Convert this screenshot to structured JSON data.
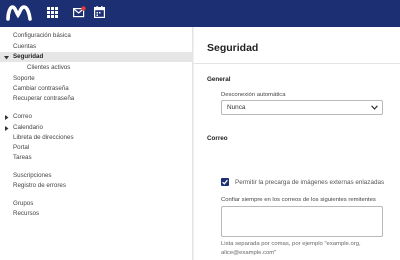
{
  "topbar": {
    "brand_color": "#1c2f73",
    "logo": "movistar-m-logo",
    "icons": [
      "apps-grid-icon",
      "mail-icon",
      "calendar-icon"
    ],
    "mail_badge_color": "#e53935"
  },
  "sidebar": {
    "items": [
      {
        "label": "Configuración básica"
      },
      {
        "label": "Cuentas"
      },
      {
        "label": "Seguridad",
        "expanded": true,
        "selected": true
      },
      {
        "label": "Clientes activos"
      },
      {
        "label": "Soporte"
      },
      {
        "label": "Cambiar contraseña"
      },
      {
        "label": "Recuperar contraseña"
      },
      {
        "label": "Correo",
        "collapsed": true
      },
      {
        "label": "Calendario",
        "collapsed": true
      },
      {
        "label": "Libreta de direcciones"
      },
      {
        "label": "Portal"
      },
      {
        "label": "Tareas"
      },
      {
        "label": "Suscripciones"
      },
      {
        "label": "Registro de errores"
      },
      {
        "label": "Grupos"
      },
      {
        "label": "Recursos"
      }
    ]
  },
  "main": {
    "title": "Seguridad",
    "general": {
      "heading": "General",
      "autologout_label": "Desconexión automática",
      "autologout_value": "Nunca"
    },
    "mail": {
      "heading": "Correo",
      "preload_images_label": "Permitir la precarga de imágenes externas enlazadas",
      "preload_images_checked": true,
      "trusted_senders_label": "Confiar siempre en los correos de los siguientes remitentes",
      "trusted_senders_value": "",
      "hint": "Lista separada por comas, por ejemplo \"example.org, alice@example.com\""
    }
  }
}
